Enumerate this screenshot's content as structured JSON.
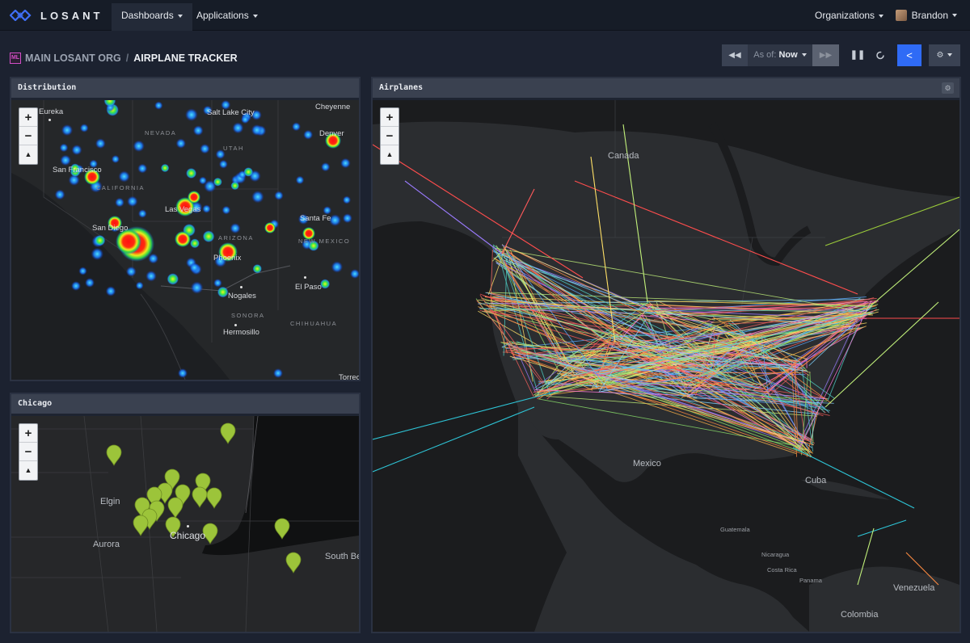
{
  "nav": {
    "brand": "LOSANT",
    "dashboards": "Dashboards",
    "applications": "Applications",
    "organizations": "Organizations",
    "user": "Brandon"
  },
  "breadcrumb": {
    "badge": "ML",
    "org": "MAIN LOSANT ORG",
    "separator": "/",
    "title": "AIRPLANE TRACKER"
  },
  "toolbar": {
    "rewind_icon": "rewind-icon",
    "as_of_label": "As of:",
    "as_of_value": "Now",
    "forward_icon": "fast-forward-icon",
    "pause_icon": "pause-icon",
    "refresh_icon": "refresh-icon",
    "share_icon": "share-icon",
    "settings_icon": "gear-icon",
    "colors": {
      "share": "#2f6bf6",
      "button": "#3a4253"
    }
  },
  "panels": {
    "distribution": {
      "title": "Distribution",
      "labels": [
        "Eureka",
        "Salt Lake City",
        "Cheyenne",
        "NEVADA",
        "UTAH",
        "Denver",
        "San Francisco",
        "CALIFORNIA",
        "Las Vegas",
        "Santa Fe",
        "ARIZONA",
        "NEW MEXICO",
        "San Diego",
        "Phoenix",
        "El Paso",
        "Nogales",
        "SONORA",
        "Hermosillo",
        "CHIHUAHUA",
        "Torreon"
      ]
    },
    "chicago": {
      "title": "Chicago",
      "labels": [
        "Elgin",
        "Aurora",
        "Chicago",
        "South Be"
      ]
    },
    "airplanes": {
      "title": "Airplanes",
      "labels": [
        "Canada",
        "Mexico",
        "Cuba",
        "Guatemala",
        "Nicaragua",
        "Costa Rica",
        "Panama",
        "Venezuela",
        "Colombia"
      ]
    }
  },
  "map_controls": {
    "zoom_in": "+",
    "zoom_out": "−",
    "reset": "▲"
  }
}
